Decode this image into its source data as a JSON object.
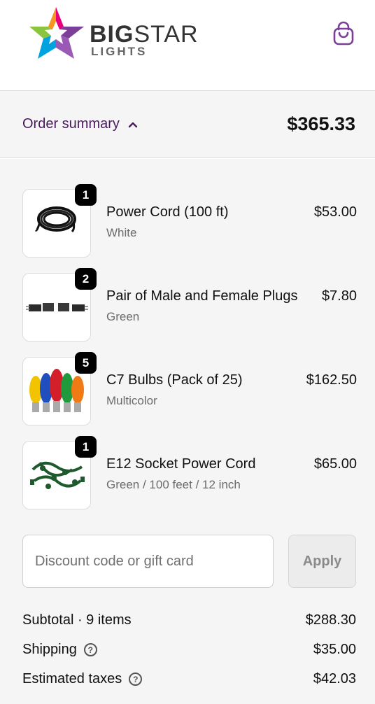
{
  "brand": {
    "name_big": "BIG",
    "name_star": "STAR",
    "name_small": "LIGHTS",
    "colors": [
      "#e6007e",
      "#8bc53f",
      "#00a3e0",
      "#7c3f98",
      "#f7941d"
    ]
  },
  "header": {
    "cart_icon": "shopping-bag-icon",
    "cart_color": "#7c3f98"
  },
  "summary": {
    "toggle_label": "Order summary",
    "toggle_icon": "chevron-up-icon",
    "total": "$365.33",
    "accent_color": "#4a1a5e"
  },
  "items": [
    {
      "name": "Power Cord (100 ft)",
      "variant": "White",
      "price": "$53.00",
      "quantity": "1",
      "image_icon": "coiled-cord-icon"
    },
    {
      "name": "Pair of Male and Female Plugs",
      "variant": "Green",
      "price": "$7.80",
      "quantity": "2",
      "image_icon": "plugs-icon"
    },
    {
      "name": "C7 Bulbs (Pack of 25)",
      "variant": "Multicolor",
      "price": "$162.50",
      "quantity": "5",
      "image_icon": "bulbs-icon"
    },
    {
      "name": "E12 Socket Power Cord",
      "variant": "Green / 100 feet / 12 inch",
      "price": "$65.00",
      "quantity": "1",
      "image_icon": "socket-cord-icon"
    }
  ],
  "discount": {
    "placeholder": "Discount code or gift card",
    "apply_label": "Apply"
  },
  "totals": {
    "subtotal_label": "Subtotal · 9 items",
    "subtotal_value": "$288.30",
    "shipping_label": "Shipping",
    "shipping_value": "$35.00",
    "taxes_label": "Estimated taxes",
    "taxes_value": "$42.03",
    "help_icon": "question-circle-icon"
  }
}
